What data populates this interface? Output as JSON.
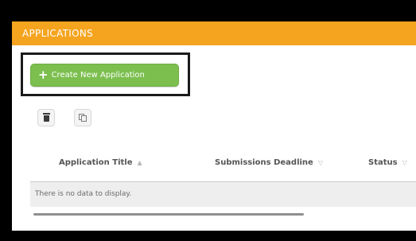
{
  "header": {
    "title": "APPLICATIONS"
  },
  "toolbar": {
    "create_label": "Create New Application",
    "create_icon": "plus-icon",
    "delete_icon": "trash-icon",
    "copy_icon": "copy-icon"
  },
  "table": {
    "columns": [
      {
        "label": "Application Title",
        "sort": "▲"
      },
      {
        "label": "Submissions Deadline",
        "sort": "▽"
      },
      {
        "label": "Status",
        "sort": "▽"
      }
    ],
    "empty_message": "There is no data to display."
  },
  "colors": {
    "header": "#f5a41f",
    "create_button": "#7cbf4f",
    "highlight_border": "#1b1b1b"
  }
}
